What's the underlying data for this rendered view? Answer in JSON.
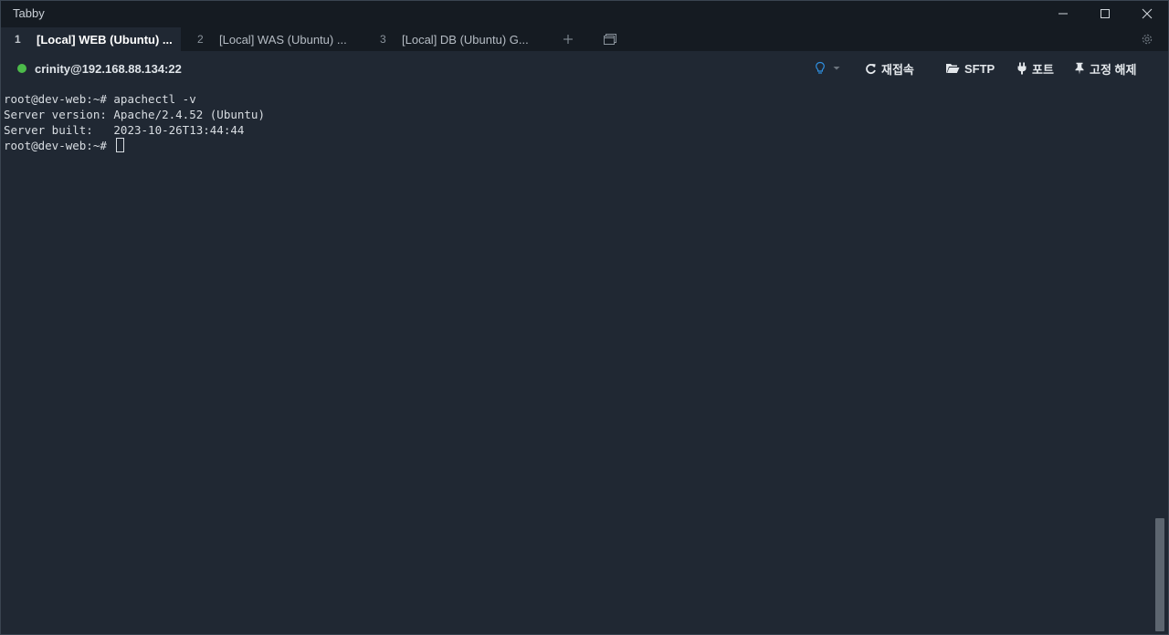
{
  "app": {
    "title": "Tabby"
  },
  "window_controls": {
    "minimize_icon": "minimize-icon",
    "maximize_icon": "maximize-icon",
    "close_icon": "close-icon"
  },
  "tabs": [
    {
      "number": "1",
      "label": "[Local] WEB (Ubuntu) ...",
      "active": true
    },
    {
      "number": "2",
      "label": "[Local] WAS (Ubuntu) ...",
      "active": false
    },
    {
      "number": "3",
      "label": "[Local] DB (Ubuntu) G...",
      "active": false
    }
  ],
  "tab_actions": {
    "add_icon": "plus-icon",
    "layout_icon": "layout-icon",
    "settings_icon": "gear-icon"
  },
  "session": {
    "status": "connected",
    "status_color": "#4cbb4a",
    "host": "crinity@192.168.88.134:22"
  },
  "toolbar": {
    "reconnect_label": "재접속",
    "sftp_label": "SFTP",
    "ports_label": "포트",
    "unpin_label": "고정 해제"
  },
  "terminal": {
    "lines": [
      "root@dev-web:~# apachectl -v",
      "Server version: Apache/2.4.52 (Ubuntu)",
      "Server built:   2023-10-26T13:44:44",
      "root@dev-web:~# "
    ]
  },
  "colors": {
    "background": "#202833",
    "titlebar": "#151b22",
    "accent": "#2f8fdf"
  }
}
